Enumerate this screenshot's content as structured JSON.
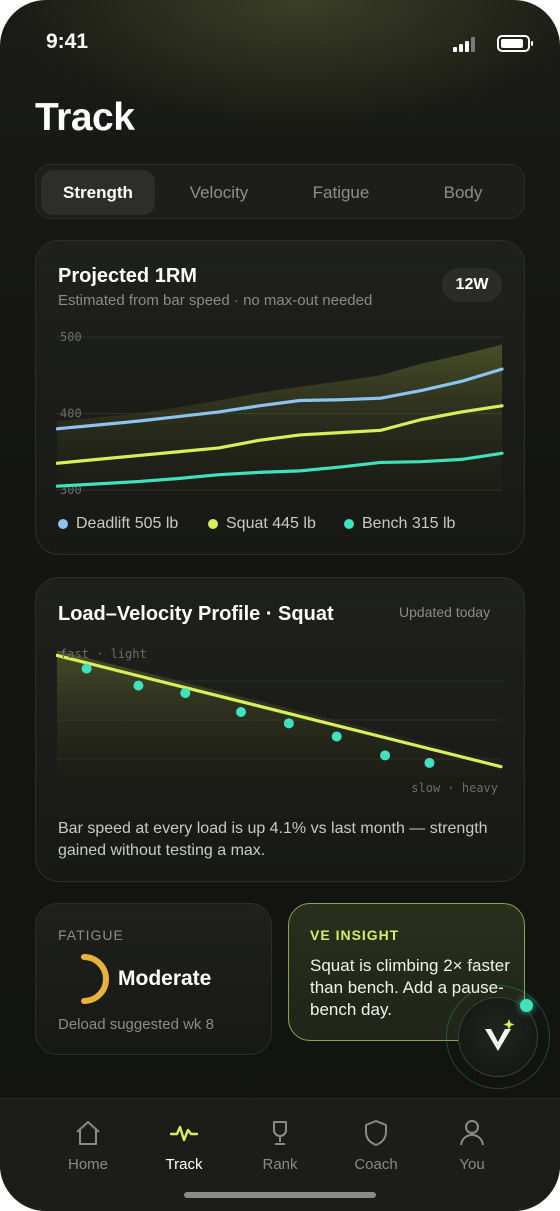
{
  "status": {
    "time": "9:41"
  },
  "title": "Track",
  "tabs": [
    {
      "label": "Strength",
      "active": true
    },
    {
      "label": "Velocity",
      "active": false
    },
    {
      "label": "Fatigue",
      "active": false
    },
    {
      "label": "Body",
      "active": false
    }
  ],
  "projected": {
    "title": "Projected 1RM",
    "subtitle": "Estimated from bar speed · no max-out needed",
    "range_pill": "12W",
    "legend": [
      {
        "label": "Deadlift 505 lb",
        "color": "#8bc4f0"
      },
      {
        "label": "Squat 445 lb",
        "color": "#d6ef5a"
      },
      {
        "label": "Bench 315 lb",
        "color": "#3fe2bd"
      }
    ]
  },
  "load_velocity": {
    "title": "Load–Velocity Profile · Squat",
    "updated": "Updated today",
    "axis_top": "fast · light",
    "axis_bottom": "slow · heavy",
    "note": "Bar speed at every load is up 4.1% vs last month — strength gained without testing a max."
  },
  "fatigue": {
    "label": "FATIGUE",
    "value": "Moderate",
    "note": "Deload suggested wk 8",
    "level": 0.65,
    "color": "#e9b23c"
  },
  "insight": {
    "label": "VE INSIGHT",
    "text": "Squat is climbing 2× faster than bench. Add a pause-bench day."
  },
  "nav": [
    {
      "label": "Home",
      "icon": "home-icon",
      "active": false
    },
    {
      "label": "Track",
      "icon": "pulse-icon",
      "active": true
    },
    {
      "label": "Rank",
      "icon": "trophy-icon",
      "active": false
    },
    {
      "label": "Coach",
      "icon": "shield-icon",
      "active": false
    },
    {
      "label": "You",
      "icon": "user-icon",
      "active": false
    }
  ],
  "chart_data": [
    {
      "type": "line",
      "title": "Projected 1RM",
      "x": [
        1,
        2,
        3,
        4,
        5,
        6,
        7,
        8,
        9,
        10,
        11,
        12
      ],
      "ylim": [
        300,
        500
      ],
      "yticks": [
        500,
        400,
        300
      ],
      "series": [
        {
          "name": "Deadlift 505 lb",
          "color": "#8bc4f0",
          "values": [
            380,
            385,
            390,
            396,
            402,
            410,
            417,
            418,
            420,
            430,
            442,
            458
          ]
        },
        {
          "name": "Squat 445 lb",
          "color": "#d6ef5a",
          "values": [
            335,
            340,
            345,
            350,
            355,
            365,
            372,
            375,
            378,
            392,
            402,
            410
          ]
        },
        {
          "name": "Bench 315 lb",
          "color": "#3fe2bd",
          "values": [
            305,
            308,
            311,
            315,
            320,
            323,
            325,
            330,
            336,
            337,
            340,
            348
          ]
        }
      ],
      "band_upper": [
        390,
        395,
        400,
        408,
        417,
        427,
        435,
        442,
        450,
        465,
        477,
        490
      ],
      "legend": "bottom"
    },
    {
      "type": "scatter",
      "title": "Load–Velocity Profile · Squat",
      "x": [
        1,
        2,
        3,
        4,
        5,
        6,
        7,
        8
      ],
      "values": [
        0.88,
        0.79,
        0.75,
        0.65,
        0.59,
        0.52,
        0.42,
        0.38
      ],
      "trend": [
        [
          0,
          0.95
        ],
        [
          9,
          0.36
        ]
      ],
      "ylim": [
        0.3,
        1.0
      ],
      "color": "#3fe2bd",
      "trend_color": "#d6ef5a"
    }
  ]
}
